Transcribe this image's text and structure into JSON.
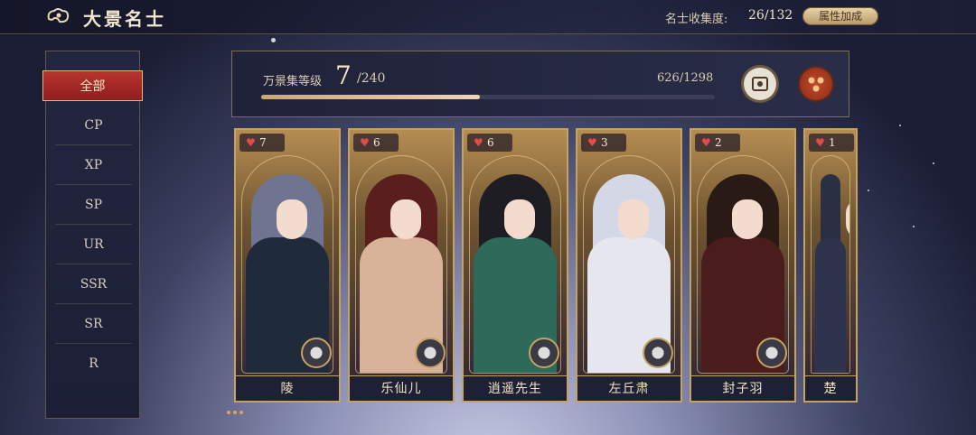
{
  "header": {
    "title": "大景名士",
    "collection_label": "名士收集度:",
    "collection_value": "26/132",
    "attr_button": "属性加成"
  },
  "sidebar": {
    "items": [
      {
        "label": "全部",
        "active": true
      },
      {
        "label": "CP"
      },
      {
        "label": "XP"
      },
      {
        "label": "SP"
      },
      {
        "label": "UR"
      },
      {
        "label": "SSR"
      },
      {
        "label": "SR"
      },
      {
        "label": "R"
      }
    ]
  },
  "level": {
    "label": "万景集等级",
    "current": "7",
    "max": "/240",
    "exp": "626/1298",
    "progress": 0.482
  },
  "cards": [
    {
      "name": "陵",
      "likes": "7",
      "hair": "#6f7591",
      "robe": "#1f2a3a"
    },
    {
      "name": "乐仙儿",
      "likes": "6",
      "hair": "#5a1f1c",
      "robe": "#d9b29a"
    },
    {
      "name": "逍遥先生",
      "likes": "6",
      "hair": "#1e1d24",
      "robe": "#2e6a5a"
    },
    {
      "name": "左丘肃",
      "likes": "3",
      "hair": "#d3d7e6",
      "robe": "#e6e6ee"
    },
    {
      "name": "封子羽",
      "likes": "2",
      "hair": "#2a1a16",
      "robe": "#4a1c1c"
    },
    {
      "name": "楚",
      "likes": "1",
      "hair": "#2b2f44",
      "robe": "#2e344e"
    }
  ]
}
